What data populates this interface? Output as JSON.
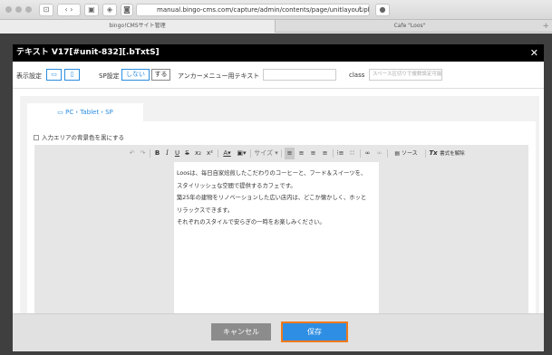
{
  "browser": {
    "url": "manual.bingo-cms.com/capture/admin/contents/page/unitlayout.php?pidx_con",
    "tabs": [
      "bingo!CMSサイト管理",
      "Cafe \"Loos\""
    ],
    "new_tab": "+"
  },
  "modal": {
    "title": "テキスト V17[#unit-832][.bTxtS]",
    "close": "✕",
    "settings": {
      "display_label": "表示設定",
      "sp_label": "SP設定",
      "sp_off": "しない",
      "sp_on": "する",
      "anchor_label": "アンカーメニュー用テキスト",
      "anchor_value": "",
      "class_label": "class",
      "class_placeholder": "スペース区切りで複数設定可能"
    },
    "device_tab": "PC・Tablet・SP",
    "bg_checkbox_label": "入力エリアの背景色を黒にする",
    "toolbar": {
      "size_label": "サイズ",
      "source_label": "ソース",
      "clear_format_label": "書式を解除"
    },
    "content": [
      "Loosは、毎日自家焙煎したこだわりのコーヒーと、フード＆スイーツを、",
      "スタイリッシュな空間で提供するカフェです。",
      "築25年の建物をリノベーションした広い店内は、どこか懐かしく、ホッと",
      "リラックスできます。",
      "それぞれのスタイルで安らぎの一時をお楽しみください。"
    ],
    "cancel": "キャンセル",
    "save": "保存"
  },
  "colors": {
    "accent": "#2e8ee3",
    "highlight": "#f07a1c",
    "header": "#000000"
  }
}
